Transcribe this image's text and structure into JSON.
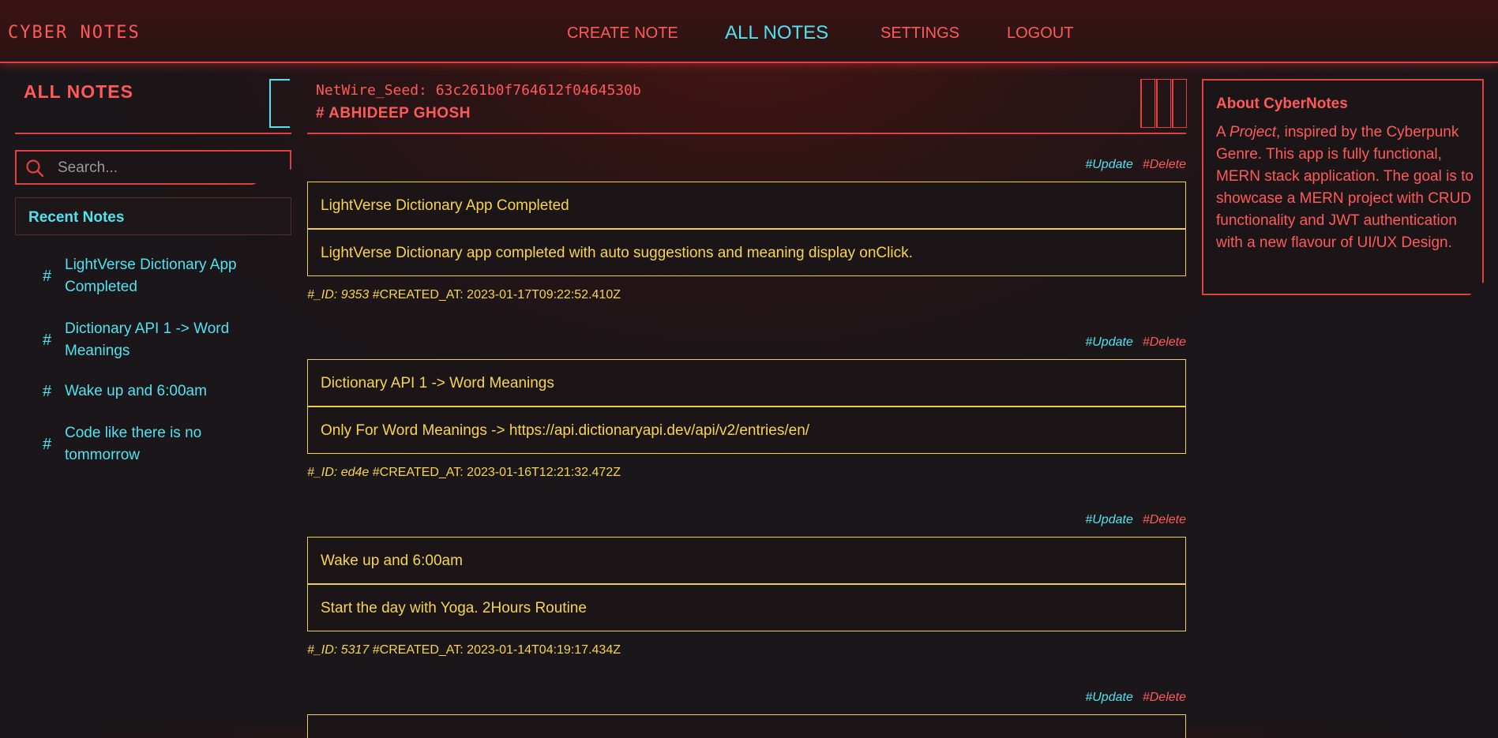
{
  "nav": {
    "brand": "CYBER NOTES",
    "links": [
      {
        "label": "CREATE NOTE"
      },
      {
        "label": "ALL NOTES"
      },
      {
        "label": "SETTINGS"
      },
      {
        "label": "LOGOUT"
      }
    ],
    "active": "ALL NOTES"
  },
  "sidebar": {
    "title": "ALL NOTES",
    "search_placeholder": "Search...",
    "recent_title": "Recent Notes",
    "recent": [
      {
        "hash": "#",
        "label": "LightVerse Dictionary App Completed"
      },
      {
        "hash": "#",
        "label": "Dictionary API 1 -> Word Meanings"
      },
      {
        "hash": "#",
        "label": "Wake up and 6:00am"
      },
      {
        "hash": "#",
        "label": "Code like there is no tommorrow"
      }
    ]
  },
  "header": {
    "seed": "NetWire_Seed: 63c261b0f764612f0464530b",
    "user": "# ABHIDEEP GHOSH"
  },
  "notes": [
    {
      "update_label": "#Update",
      "delete_label": "#Delete",
      "title": "LightVerse Dictionary App Completed",
      "body": "LightVerse Dictionary app completed with auto suggestions and meaning display onClick.",
      "id_label": "#_ID: 9353",
      "created": "#CREATED_AT: 2023-01-17T09:22:52.410Z"
    },
    {
      "update_label": "#Update",
      "delete_label": "#Delete",
      "title": "Dictionary API 1 -> Word Meanings",
      "body": "Only For Word Meanings -> https://api.dictionaryapi.dev/api/v2/entries/en/",
      "id_label": "#_ID: ed4e",
      "created": "#CREATED_AT: 2023-01-16T12:21:32.472Z"
    },
    {
      "update_label": "#Update",
      "delete_label": "#Delete",
      "title": "Wake up and 6:00am",
      "body": "Start the day with Yoga. 2Hours Routine",
      "id_label": "#_ID: 5317",
      "created": "#CREATED_AT: 2023-01-14T04:19:17.434Z"
    },
    {
      "update_label": "#Update",
      "delete_label": "#Delete"
    }
  ],
  "about": {
    "title": "About CyberNotes",
    "text_prefix": "A ",
    "text_em": "Project",
    "text_rest": ", inspired by the Cyberpunk Genre. This app is fully functional, MERN stack application. The goal is to showcase a MERN project with CRUD functionality and JWT authentication with a new flavour of UI/UX Design."
  },
  "colors": {
    "accent_red": "#ff5a5a",
    "accent_cyan": "#4fe3f0",
    "note_yellow": "#f7d44c",
    "panel_bg": "#1c1518"
  }
}
